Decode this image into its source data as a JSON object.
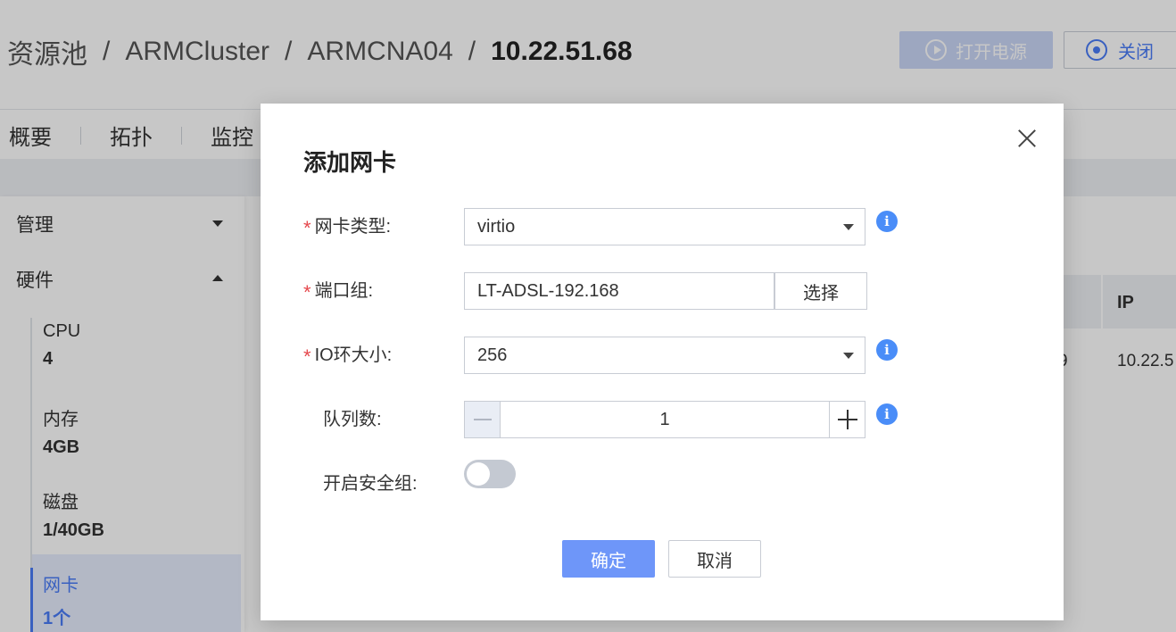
{
  "breadcrumb": {
    "items": [
      "资源池",
      "ARMCluster",
      "ARMCNA04"
    ],
    "current": "10.22.51.68",
    "separator": "/"
  },
  "header_actions": {
    "power_on_label": "打开电源",
    "close_label": "关闭"
  },
  "tabs": [
    "概要",
    "拓扑",
    "监控"
  ],
  "sidebar": {
    "groups": [
      {
        "label": "管理",
        "expanded": false
      },
      {
        "label": "硬件",
        "expanded": true
      }
    ],
    "hardware": [
      {
        "label": "CPU",
        "value": "4"
      },
      {
        "label": "内存",
        "value": "4GB"
      },
      {
        "label": "磁盘",
        "value": "1/40GB"
      },
      {
        "label": "网卡",
        "value": "1个",
        "active": true
      }
    ]
  },
  "table": {
    "header_ip": "IP",
    "row_partial_left": "9",
    "row_ip": "10.22.5"
  },
  "dialog": {
    "title": "添加网卡",
    "fields": {
      "nic_type": {
        "label": "网卡类型:",
        "value": "virtio"
      },
      "port_group": {
        "label": "端口组:",
        "value": "LT-ADSL-192.168",
        "button": "选择"
      },
      "io_ring": {
        "label": "IO环大小:",
        "value": "256"
      },
      "queue_count": {
        "label": "队列数:",
        "value": "1"
      },
      "security_group": {
        "label": "开启安全组:",
        "enabled": false
      }
    },
    "required_mark": "*",
    "info_glyph": "i",
    "ok_label": "确定",
    "cancel_label": "取消"
  },
  "colors": {
    "accent": "#4a7cf6",
    "primary_button": "#6e96f9",
    "required": "#e5484d",
    "info": "#4a8df8"
  }
}
